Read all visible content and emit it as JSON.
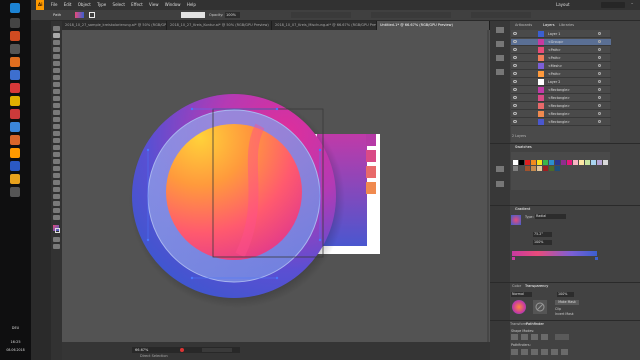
{
  "app": {
    "menus": [
      "Ai",
      "File",
      "Edit",
      "Object",
      "Type",
      "Select",
      "Effect",
      "View",
      "Window",
      "Help"
    ],
    "tabs": [
      "2018_10_27_sample_kreiskolorierung.ai* @ 50% (RGB/GPU Preview)",
      "2018_10_27_Kreis_Kontur.ai* @ 50% (RGB/GPU Preview)",
      "2018_10_07_Kreis_Mischung.ai* @ 66.67% (RGB/GPU Preview)",
      "Untitled-1* @ 66.67% (RGB/GPU Preview)"
    ],
    "control": {
      "selection_label": "Path",
      "opacity_label": "Opacity:",
      "opacity_value": "100%"
    },
    "zoom": "66.67%",
    "status": "Direct Selection",
    "workspace": "Layout"
  },
  "taskbar": {
    "time": "16:25",
    "date": "08.06.2018",
    "lang": "DEU"
  },
  "layers_panel": {
    "tabs": [
      "Artboards",
      "Layers",
      "Libraries"
    ],
    "active_tab": "Layers",
    "rows": [
      "Layer 1",
      "<Group>",
      "<Path>",
      "<Path>",
      "<Mesh>",
      "<Path>",
      "Layer 2",
      "<Rectangle>",
      "<Rectangle>",
      "<Rectangle>",
      "<Rectangle>",
      "<Rectangle>"
    ],
    "footer": "2 Layers"
  },
  "swatches_panel": {
    "title": "Swatches",
    "colors": [
      "#ffffff",
      "#000000",
      "#e02020",
      "#f28a1e",
      "#f5e31c",
      "#3ab54a",
      "#2c8ecf",
      "#2a3590",
      "#8e2d8e",
      "#e8177b",
      "#f7b3c2",
      "#fde7a4",
      "#c8e6a0",
      "#a9d4f0",
      "#b7a6d6",
      "#d9d9d9",
      "#7f7f7f",
      "#4d4d4d",
      "#a0522d",
      "#c58b4e",
      "#e2c59a",
      "#9b1d20",
      "#4a6b2a",
      "#1f4e79"
    ]
  },
  "gradient_panel": {
    "title": "Gradient",
    "type_label": "Type:",
    "type_value": "Radial",
    "angle": "75.2°",
    "ratio": "100%",
    "stops": [
      "#c83aa0",
      "#e84b7a",
      "#f07d58",
      "#7c5fd6",
      "#3b5fd0"
    ]
  },
  "transparency_panel": {
    "tabs": [
      "Color",
      "Transparency"
    ],
    "mode": "Normal",
    "opacity": "100%",
    "make_mask": "Make Mask",
    "clip": "Clip",
    "invert": "Invert Mask"
  },
  "bottom_panel": {
    "tabs": [
      "Transform",
      "Pathfinder"
    ],
    "shape_modes": "Shape Modes:",
    "pathfinders": "Pathfinders:"
  },
  "colors": {
    "accent": "#2f80ed",
    "panel_bg": "#424242",
    "canvas_bg": "#535353"
  }
}
